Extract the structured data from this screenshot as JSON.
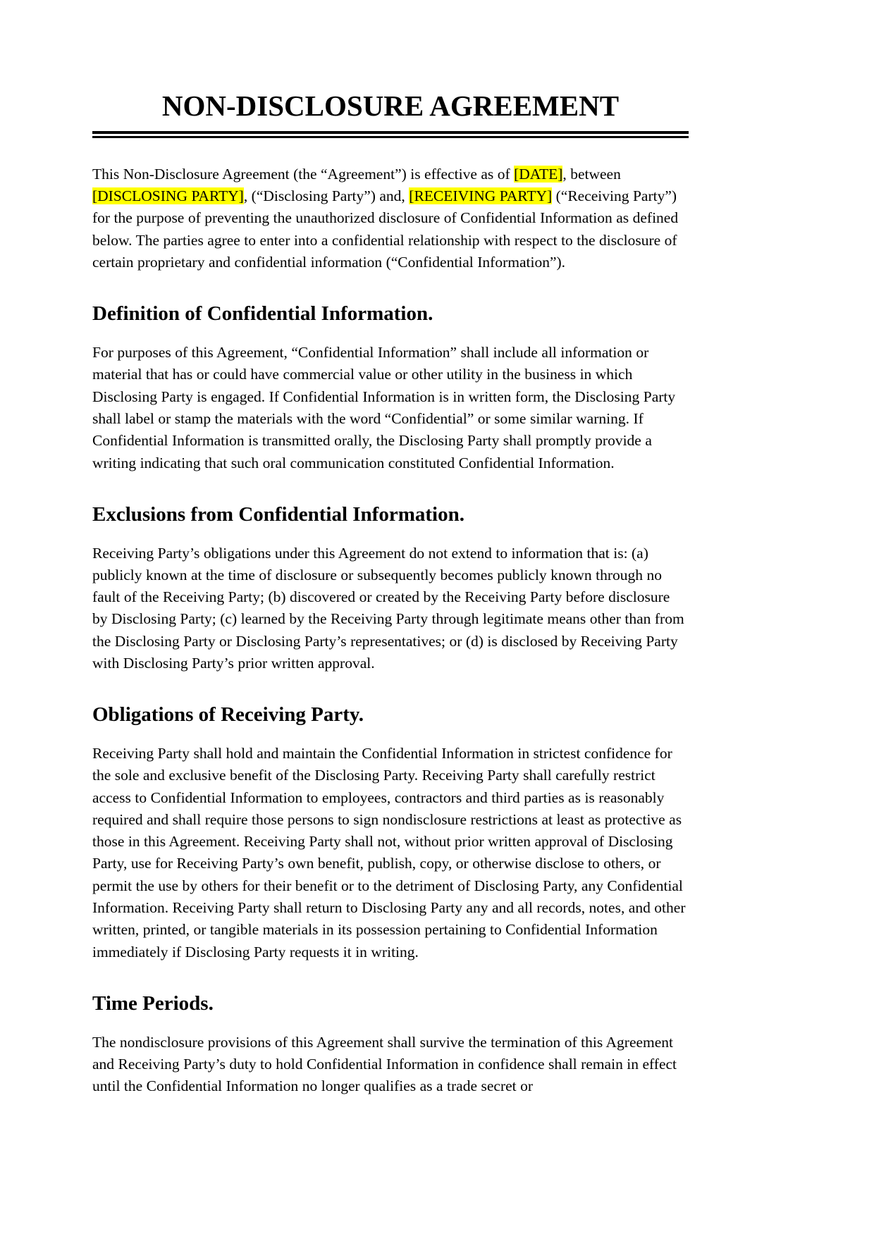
{
  "document": {
    "title": "NON-DISCLOSURE AGREEMENT",
    "highlight_color": "#ffff00",
    "text_color": "#000000",
    "page_background": "#ffffff"
  },
  "intro": {
    "part1": "This Non-Disclosure Agreement (the “Agreement”) is effective as of ",
    "placeholder_date": "[DATE]",
    "part2": ", between ",
    "placeholder_disclosing": "[DISCLOSING PARTY]",
    "part3": ", (“Disclosing Party”) and, ",
    "placeholder_receiving": "[RECEIVING PARTY]",
    "part4": " (“Receiving Party”) for the purpose of preventing the unauthorized disclosure of Confidential Information as defined below. The parties agree to enter into a confidential relationship with respect to the disclosure of certain proprietary and confidential information (“Confidential Information”)."
  },
  "sections": [
    {
      "heading": "Definition of Confidential Information.",
      "body": "For purposes of this Agreement, “Confidential Information” shall include all information or material that has or could have commercial value or other utility in the business in which Disclosing Party is engaged. If Confidential Information is in written form, the Disclosing Party shall label or stamp the materials with the word “Confidential” or some similar warning. If Confidential Information is transmitted orally, the Disclosing Party shall promptly provide a writing indicating that such oral communication constituted Confidential Information."
    },
    {
      "heading": "Exclusions from Confidential Information.",
      "body": "Receiving Party’s obligations under this Agreement do not extend to information that is: (a) publicly known at the time of disclosure or subsequently becomes publicly known through no fault of the Receiving Party; (b) discovered or created by the Receiving Party before disclosure by Disclosing Party; (c) learned by the Receiving Party through legitimate means other than from the Disclosing Party or Disclosing Party’s representatives; or (d) is disclosed by Receiving Party with Disclosing Party’s prior written approval."
    },
    {
      "heading": "Obligations of Receiving Party.",
      "body": "Receiving Party shall hold and maintain the Confidential Information in strictest confidence for the sole and exclusive benefit of the Disclosing Party. Receiving Party shall carefully restrict access to Confidential Information to employees, contractors and third parties as is reasonably required and shall require those persons to sign nondisclosure restrictions at least as protective as those in this Agreement. Receiving Party shall not, without prior written approval of Disclosing Party, use for Receiving Party’s own benefit, publish, copy, or otherwise disclose to others, or permit the use by others for their benefit or to the detriment of Disclosing Party, any Confidential Information. Receiving Party shall return to Disclosing Party any and all records, notes, and other written, printed, or tangible materials in its possession pertaining to Confidential Information immediately if Disclosing Party requests it in writing."
    },
    {
      "heading": "Time Periods.",
      "body": "The nondisclosure provisions of this Agreement shall survive the termination of this Agreement and Receiving Party’s duty to hold Confidential Information in confidence shall remain in effect until the Confidential Information no longer qualifies as a trade secret or"
    }
  ]
}
